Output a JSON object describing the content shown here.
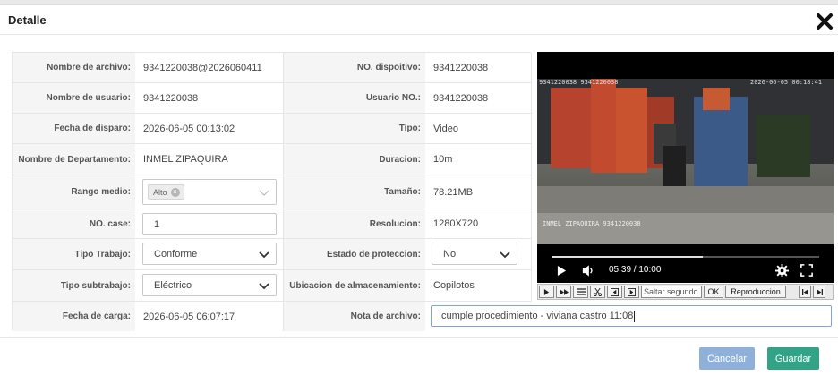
{
  "dialog": {
    "title": "Detalle"
  },
  "fields": {
    "file_name": {
      "label": "Nombre de archivo:",
      "value": "9341220038@2026060411"
    },
    "device_no": {
      "label": "NO. dispoitivo:",
      "value": "9341220038"
    },
    "user_name": {
      "label": "Nombre de usuario:",
      "value": "9341220038"
    },
    "user_no": {
      "label": "Usuario NO.:",
      "value": "9341220038"
    },
    "trigger_date": {
      "label": "Fecha de disparo:",
      "value": "2026-06-05 00:13:02"
    },
    "type": {
      "label": "Tipo:",
      "value": "Video"
    },
    "department": {
      "label": "Nombre de Departamento:",
      "value": "INMEL ZIPAQUIRA"
    },
    "duration": {
      "label": "Duracion:",
      "value": "10m"
    },
    "range": {
      "label": "Rango medio:",
      "tag": "Alto"
    },
    "size": {
      "label": "Tamaño:",
      "value": "78.21MB"
    },
    "case_no": {
      "label": "NO. case:",
      "value": "1"
    },
    "resolution": {
      "label": "Resolucion:",
      "value": "1280X720"
    },
    "work_type": {
      "label": "Tipo Trabajo:",
      "value": "Conforme"
    },
    "protection": {
      "label": "Estado de proteccion:",
      "value": "No"
    },
    "sub_work": {
      "label": "Tipo subtrabajo:",
      "value": "Eléctrico"
    },
    "storage": {
      "label": "Ubicacion de almacenamiento:",
      "value": "Copilotos"
    },
    "upload_date": {
      "label": "Fecha de carga:",
      "value": "2026-06-05 06:07:17"
    },
    "note": {
      "label": "Nota de archivo:",
      "value": "cumple procedimiento - viviana castro  11:08"
    }
  },
  "video": {
    "time": "05:39 / 10:00",
    "progress": 0.565,
    "osd_top_left": "9341220038 9341220038",
    "osd_top_right": "2026-06-05 00:18:41",
    "osd_bottom": "INMEL ZIPAQUIRA  9341220038"
  },
  "player_toolbar": {
    "seek_placeholder": "Saltar segundo",
    "ok_label": "OK",
    "playback_label": "Reproduccion"
  },
  "footer": {
    "cancel_label": "Cancelar",
    "save_label": "Guardar"
  },
  "colors": {
    "cancel_bg": "#8fb0d9",
    "save_bg": "#33a388"
  }
}
